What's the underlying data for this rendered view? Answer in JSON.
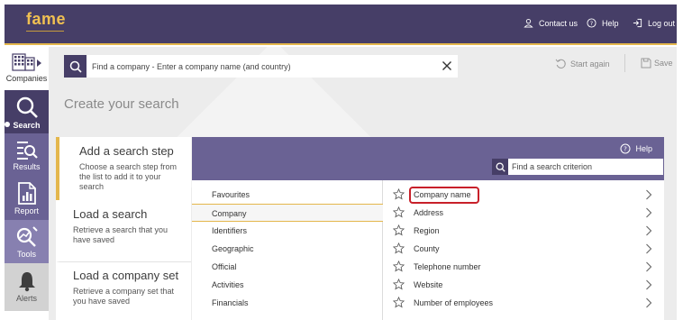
{
  "app": {
    "logo": "fame"
  },
  "header": {
    "contact_label": "Contact us",
    "help_label": "Help",
    "logout_label": "Log out"
  },
  "nav": {
    "companies": "Companies",
    "search": "Search",
    "results": "Results",
    "report": "Report",
    "tools": "Tools",
    "alerts": "Alerts"
  },
  "toolbar": {
    "search_placeholder": "Find a company - Enter a company name (and country)",
    "start_again": "Start again",
    "save": "Save"
  },
  "page_title": "Create your search",
  "panel": {
    "help_label": "Help",
    "criterion_placeholder": "Find a search criterion",
    "cards": [
      {
        "title": "Add a search step",
        "desc": "Choose a search step from the list to add it to your search"
      },
      {
        "title": "Load a search",
        "desc": "Retrieve a search that you have saved"
      },
      {
        "title": "Load a company set",
        "desc": "Retrieve a company set that you have saved"
      }
    ],
    "categories": [
      "Favourites",
      "Company",
      "Identifiers",
      "Geographic",
      "Official",
      "Activities",
      "Financials"
    ],
    "active_category": "Company",
    "criteria": [
      "Company name",
      "Address",
      "Region",
      "County",
      "Telephone number",
      "Website",
      "Number of employees"
    ],
    "highlighted_criterion": "Company name"
  },
  "colors": {
    "header_bg": "#463e67",
    "accent_gold": "#e4b74c",
    "panel_purple": "#6a6294",
    "highlight_red": "#c8202a"
  }
}
